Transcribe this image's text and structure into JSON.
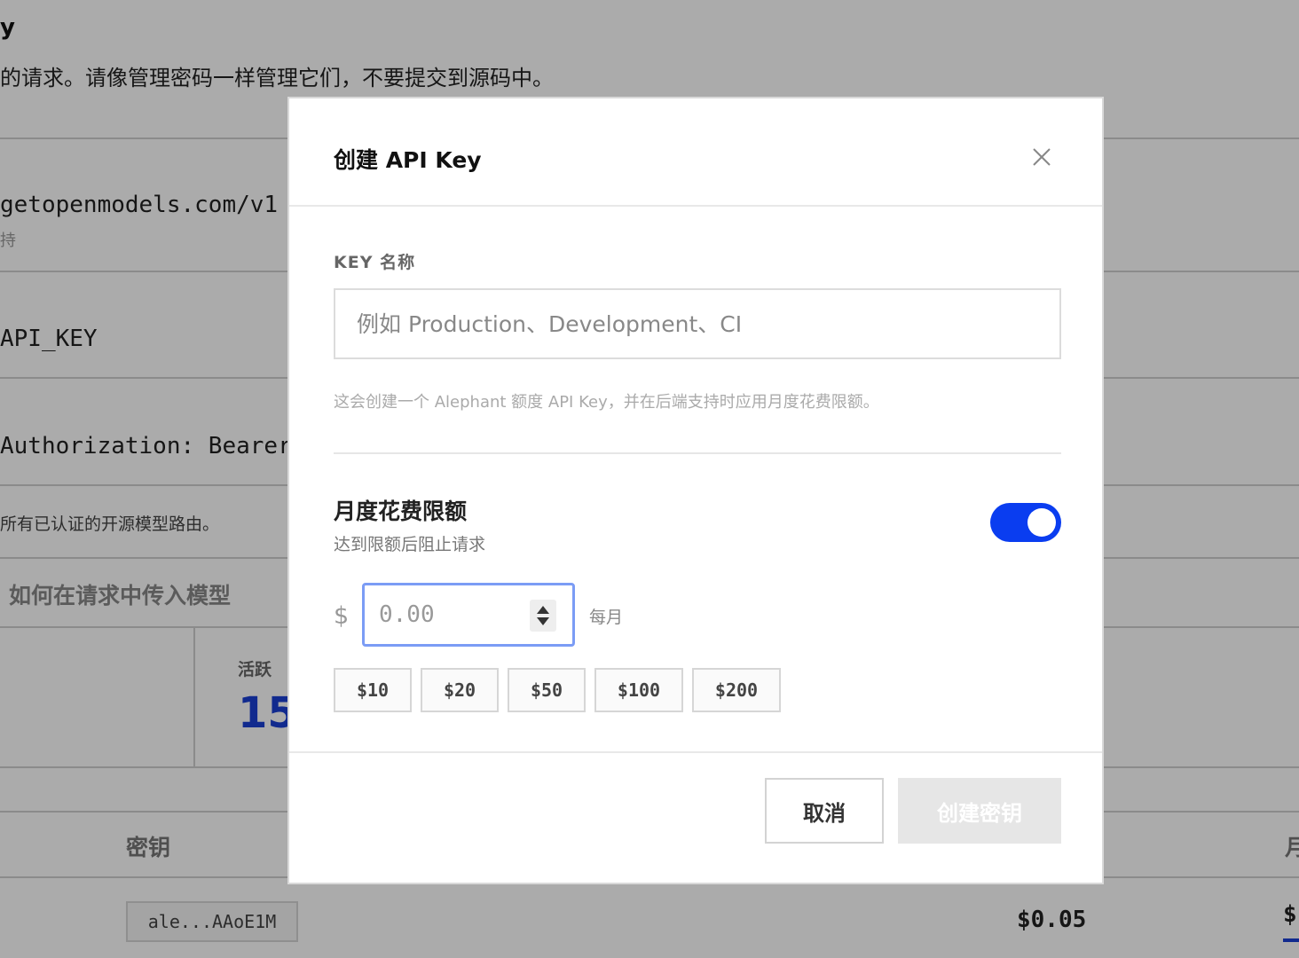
{
  "background": {
    "title_fragment": "y",
    "description_fragment": "的请求。请像管理密码一样管理它们，不要提交到源码中。",
    "base_url_fragment": "getopenmodels.com/v1",
    "base_url_sub": "持",
    "env_var_fragment": "API_KEY",
    "header_fragment": " Authorization: Bearer",
    "routes_fragment": "所有已认证的开源模型路由。",
    "howto_label": "如何在请求中传入模型",
    "active_label": "活跃",
    "active_value": "15",
    "table": {
      "col_key": "密钥",
      "col_month_fragment": "月",
      "row_key": "ale...AAoE1M",
      "row_spend": "$0.05",
      "row_spend2_fragment": "$("
    }
  },
  "modal": {
    "title": "创建 API Key",
    "close_icon": "close-icon",
    "name_field": {
      "label": "KEY 名称",
      "placeholder": "例如 Production、Development、CI",
      "value": ""
    },
    "helper_text": "这会创建一个 Alephant 额度 API Key，并在后端支持时应用月度花费限额。",
    "limit": {
      "title": "月度花费限额",
      "subtitle": "达到限额后阻止请求",
      "enabled": true,
      "currency_symbol": "$",
      "amount_placeholder": "0.00",
      "amount_value": "",
      "period_label": "每月",
      "presets": [
        "$10",
        "$20",
        "$50",
        "$100",
        "$200"
      ]
    },
    "footer": {
      "cancel_label": "取消",
      "create_label": "创建密钥",
      "create_enabled": false
    }
  },
  "colors": {
    "accent": "#0a3df0",
    "overlay": "rgba(0,0,0,0.33)",
    "disabled_button": "#e6e6e6"
  }
}
